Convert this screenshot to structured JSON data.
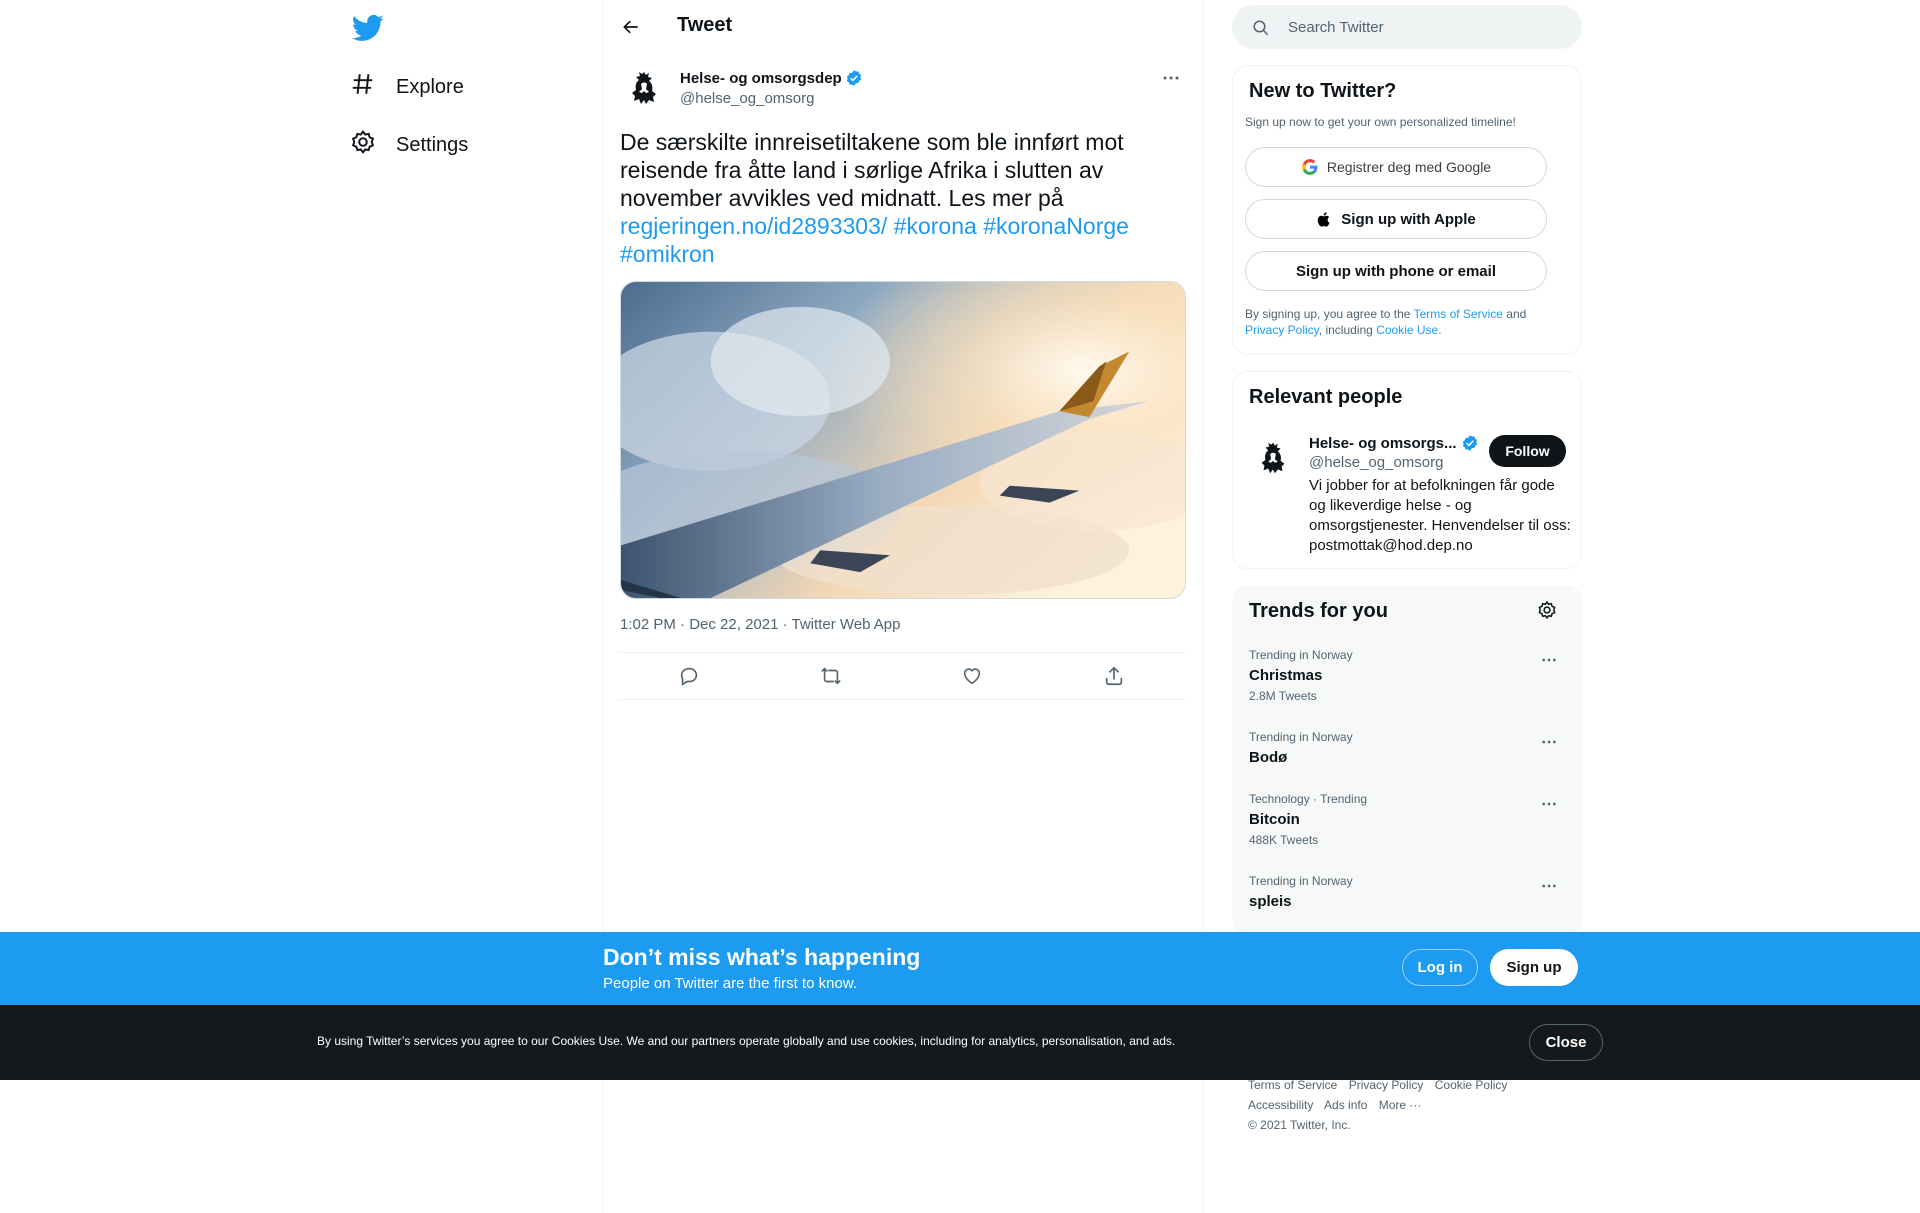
{
  "nav": {
    "logo_icon": "twitter-bird-icon",
    "items": [
      {
        "label": "Explore",
        "icon": "hashtag-icon"
      },
      {
        "label": "Settings",
        "icon": "gear-icon"
      }
    ]
  },
  "header": {
    "title": "Tweet",
    "back_icon": "arrow-left-icon"
  },
  "tweet": {
    "author_name": "Helse- og omsorgsdep",
    "author_handle": "@helse_og_omsorg",
    "verified": true,
    "text_plain": "De særskilte innreisetiltakene som ble innført mot reisende fra åtte land i sørlige Afrika i slutten av november avvikles ved midnatt. Les mer på",
    "link": "regjeringen.no/id2893303/",
    "hashtags": [
      "#korona",
      "#koronaNorge",
      "#omikron"
    ],
    "time": "1:02 PM",
    "date": "Dec 22, 2021",
    "source": "Twitter Web App",
    "actions": [
      "reply-icon",
      "retweet-icon",
      "like-icon",
      "share-icon"
    ]
  },
  "search": {
    "placeholder": "Search Twitter"
  },
  "signup": {
    "title": "New to Twitter?",
    "subtitle": "Sign up now to get your own personalized timeline!",
    "google_label": "Registrer deg med Google",
    "apple_label": "Sign up with Apple",
    "phone_label": "Sign up with phone or email",
    "legal_pre": "By signing up, you agree to the",
    "terms": "Terms of Service",
    "and": "and",
    "privacy": "Privacy Policy",
    "including": ", including",
    "cookie_use": "Cookie Use."
  },
  "people": {
    "title": "Relevant people",
    "name": "Helse- og omsorgs...",
    "handle": "@helse_og_omsorg",
    "follow_label": "Follow",
    "bio": "Vi jobber for at befolkningen får gode og likeverdige helse - og omsorgstjenester. Henvendelser til oss: postmottak@hod.dep.no"
  },
  "trends": {
    "title": "Trends for you",
    "items": [
      {
        "meta": "Trending in Norway",
        "name": "Christmas",
        "count": "2.8M Tweets"
      },
      {
        "meta": "Trending in Norway",
        "name": "Bodø",
        "count": ""
      },
      {
        "meta": "Technology · Trending",
        "name": "Bitcoin",
        "count": "488K Tweets"
      },
      {
        "meta": "Trending in Norway",
        "name": "spleis",
        "count": ""
      }
    ]
  },
  "footer": {
    "links": [
      "Terms of Service",
      "Privacy Policy",
      "Cookie Policy",
      "Accessibility",
      "Ads info",
      "More ···"
    ],
    "copyright": "© 2021 Twitter, Inc."
  },
  "banner": {
    "title": "Don’t miss what’s happening",
    "subtitle": "People on Twitter are the first to know.",
    "login_label": "Log in",
    "signup_label": "Sign up"
  },
  "cookie": {
    "text": "By using Twitter’s services you agree to our Cookies Use. We and our partners operate globally and use cookies, including for analytics, personalisation, and ads.",
    "close_label": "Close"
  },
  "colors": {
    "accent": "#1d9bf0",
    "text": "#0f1419",
    "muted": "#536471",
    "cookie_bg": "#15191c"
  }
}
